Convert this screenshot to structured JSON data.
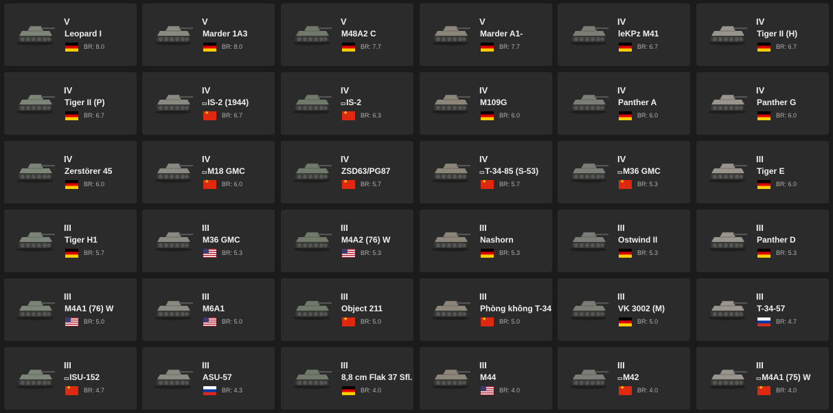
{
  "flag_colors": {
    "de": "#dd0000",
    "cn": "#de2910",
    "us": "#3c3b6e",
    "ru": "#0039a6"
  },
  "vehicles": [
    {
      "tier": "V",
      "name": "Leopard I",
      "prefix": "",
      "nation": "de",
      "br": "BR: 8.0"
    },
    {
      "tier": "V",
      "name": "Marder 1A3",
      "prefix": "",
      "nation": "de",
      "br": "BR: 8.0"
    },
    {
      "tier": "V",
      "name": "M48A2 C",
      "prefix": "",
      "nation": "de",
      "br": "BR: 7.7"
    },
    {
      "tier": "V",
      "name": "Marder A1-",
      "prefix": "",
      "nation": "de",
      "br": "BR: 7.7"
    },
    {
      "tier": "IV",
      "name": "leKPz M41",
      "prefix": "",
      "nation": "de",
      "br": "BR: 6.7"
    },
    {
      "tier": "IV",
      "name": "Tiger II (H)",
      "prefix": "",
      "nation": "de",
      "br": "BR: 6.7"
    },
    {
      "tier": "IV",
      "name": "Tiger II (P)",
      "prefix": "",
      "nation": "de",
      "br": "BR: 6.7"
    },
    {
      "tier": "IV",
      "name": "IS-2 (1944)",
      "prefix": "▭",
      "nation": "cn",
      "br": "BR: 6.7"
    },
    {
      "tier": "IV",
      "name": "IS-2",
      "prefix": "▭",
      "nation": "cn",
      "br": "BR: 6.3"
    },
    {
      "tier": "IV",
      "name": "M109G",
      "prefix": "",
      "nation": "de",
      "br": "BR: 6.0"
    },
    {
      "tier": "IV",
      "name": "Panther A",
      "prefix": "",
      "nation": "de",
      "br": "BR: 6.0"
    },
    {
      "tier": "IV",
      "name": "Panther G",
      "prefix": "",
      "nation": "de",
      "br": "BR: 6.0"
    },
    {
      "tier": "IV",
      "name": "Zerstörer 45",
      "prefix": "",
      "nation": "de",
      "br": "BR: 6.0"
    },
    {
      "tier": "IV",
      "name": "M18 GMC",
      "prefix": "▭",
      "nation": "cn",
      "br": "BR: 6.0"
    },
    {
      "tier": "IV",
      "name": "ZSD63/PG87",
      "prefix": "",
      "nation": "cn",
      "br": "BR: 5.7"
    },
    {
      "tier": "IV",
      "name": "T-34-85 (S-53)",
      "prefix": "▭",
      "nation": "cn",
      "br": "BR: 5.7"
    },
    {
      "tier": "IV",
      "name": "M36 GMC",
      "prefix": "▭",
      "nation": "cn",
      "br": "BR: 5.3"
    },
    {
      "tier": "III",
      "name": "Tiger E",
      "prefix": "",
      "nation": "de",
      "br": "BR: 6.0"
    },
    {
      "tier": "III",
      "name": "Tiger H1",
      "prefix": "",
      "nation": "de",
      "br": "BR: 5.7"
    },
    {
      "tier": "III",
      "name": "M36 GMC",
      "prefix": "",
      "nation": "us",
      "br": "BR: 5.3"
    },
    {
      "tier": "III",
      "name": "M4A2 (76) W",
      "prefix": "",
      "nation": "us",
      "br": "BR: 5.3"
    },
    {
      "tier": "III",
      "name": "Nashorn",
      "prefix": "",
      "nation": "de",
      "br": "BR: 5.3"
    },
    {
      "tier": "III",
      "name": "Ostwind II",
      "prefix": "",
      "nation": "de",
      "br": "BR: 5.3"
    },
    {
      "tier": "III",
      "name": "Panther D",
      "prefix": "",
      "nation": "de",
      "br": "BR: 5.3"
    },
    {
      "tier": "III",
      "name": "M4A1 (76) W",
      "prefix": "",
      "nation": "us",
      "br": "BR: 5.0"
    },
    {
      "tier": "III",
      "name": "M6A1",
      "prefix": "",
      "nation": "us",
      "br": "BR: 5.0"
    },
    {
      "tier": "III",
      "name": "Object 211",
      "prefix": "",
      "nation": "cn",
      "br": "BR: 5.0"
    },
    {
      "tier": "III",
      "name": "Phòng không T-34",
      "prefix": "",
      "nation": "cn",
      "br": "BR: 5.0"
    },
    {
      "tier": "III",
      "name": "VK 3002 (M)",
      "prefix": "",
      "nation": "de",
      "br": "BR: 5.0"
    },
    {
      "tier": "III",
      "name": "T-34-57",
      "prefix": "",
      "nation": "ru",
      "br": "BR: 4.7"
    },
    {
      "tier": "III",
      "name": "ISU-152",
      "prefix": "▭",
      "nation": "cn",
      "br": "BR: 4.7"
    },
    {
      "tier": "III",
      "name": "ASU-57",
      "prefix": "",
      "nation": "ru",
      "br": "BR: 4.3"
    },
    {
      "tier": "III",
      "name": "8,8 cm Flak 37 Sfl.",
      "prefix": "",
      "nation": "de",
      "br": "BR: 4.0"
    },
    {
      "tier": "III",
      "name": "M44",
      "prefix": "",
      "nation": "us",
      "br": "BR: 4.0"
    },
    {
      "tier": "III",
      "name": "M42",
      "prefix": "▭",
      "nation": "cn",
      "br": "BR: 4.0"
    },
    {
      "tier": "III",
      "name": "M4A1 (75) W",
      "prefix": "▭",
      "nation": "cn",
      "br": "BR: 4.0"
    }
  ]
}
